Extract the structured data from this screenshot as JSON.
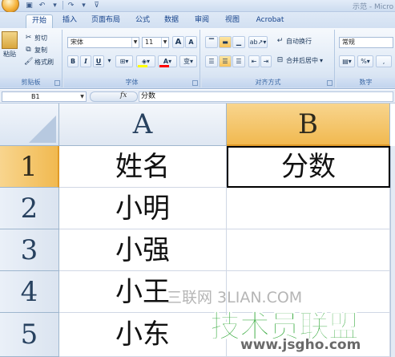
{
  "window": {
    "title": "示范 - Micro"
  },
  "ribbon": {
    "tabs": [
      "开始",
      "插入",
      "页面布局",
      "公式",
      "数据",
      "审阅",
      "视图",
      "Acrobat"
    ],
    "active_tab": "开始",
    "clipboard": {
      "paste": "粘贴",
      "cut": "剪切",
      "copy": "复制",
      "format_painter": "格式刷",
      "label": "剪贴板"
    },
    "font": {
      "name": "宋体",
      "size": "11",
      "grow": "A",
      "shrink": "A",
      "bold": "B",
      "italic": "I",
      "underline": "U",
      "font_color_letter": "A",
      "phonetic": "变",
      "label": "字体",
      "fill_color": "#ffff00",
      "text_color": "#ff0000"
    },
    "alignment": {
      "wrap_text": "自动换行",
      "merge_center": "合并后居中",
      "label": "对齐方式"
    },
    "number": {
      "format": "常规",
      "percent": "%",
      "comma": ",",
      "label": "数字"
    }
  },
  "formula_bar": {
    "name_box": "B1",
    "fx": "fx",
    "content": "分数"
  },
  "sheet": {
    "columns": [
      "A",
      "B"
    ],
    "selected_column": "B",
    "rows": [
      {
        "num": "1",
        "a": "姓名",
        "b": "分数"
      },
      {
        "num": "2",
        "a": "小明",
        "b": ""
      },
      {
        "num": "3",
        "a": "小强",
        "b": ""
      },
      {
        "num": "4",
        "a": "小王",
        "b": ""
      },
      {
        "num": "5",
        "a": "小东",
        "b": ""
      }
    ],
    "selected_row": "1",
    "active_cell": "B1"
  },
  "watermark": {
    "line1": "三联网 3LIAN.COM",
    "line2": "技术员联盟",
    "line3": "www.jsgho.com"
  }
}
